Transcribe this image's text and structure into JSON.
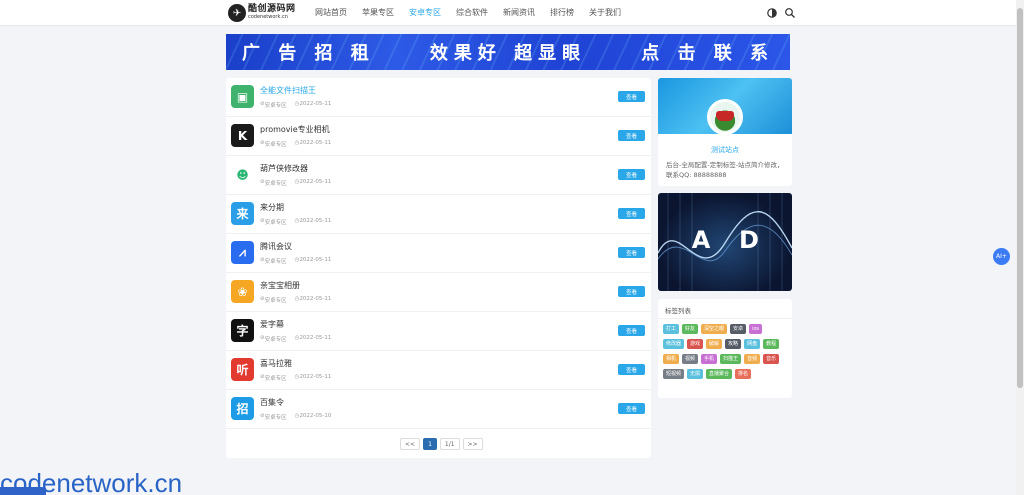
{
  "header": {
    "logo_cn": "酷创源码网",
    "logo_en": "codenetwork.cn",
    "nav": [
      {
        "label": "网站首页",
        "active": false
      },
      {
        "label": "苹果专区",
        "active": false
      },
      {
        "label": "安卓专区",
        "active": true
      },
      {
        "label": "综合软件",
        "active": false
      },
      {
        "label": "新闻资讯",
        "active": false
      },
      {
        "label": "排行榜",
        "active": false
      },
      {
        "label": "关于我们",
        "active": false
      }
    ],
    "icons": [
      "theme-toggle-icon",
      "search-icon"
    ]
  },
  "banner": {
    "text_left": "广 告 招 租",
    "text_mid": "效果好 超显眼",
    "text_right": "点 击 联 系"
  },
  "apps": [
    {
      "name": "全能文件扫描王",
      "category": "安卓专区",
      "date": "2022-05-11",
      "icon": "scanner-icon",
      "color": "#3fb36d",
      "glyph": "▣",
      "highlight": true
    },
    {
      "name": "promovie专业相机",
      "category": "安卓专区",
      "date": "2022-05-11",
      "icon": "camera-app-icon",
      "color": "#1a1a1a",
      "glyph": "K",
      "highlight": false
    },
    {
      "name": "葫芦侠修改器",
      "category": "安卓专区",
      "date": "2022-05-11",
      "icon": "gourd-icon",
      "color": "#ffffff",
      "glyph": "☻",
      "highlight": false
    },
    {
      "name": "来分期",
      "category": "安卓专区",
      "date": "2022-05-11",
      "icon": "installment-icon",
      "color": "#2a9fe8",
      "glyph": "来",
      "highlight": false
    },
    {
      "name": "腾讯会议",
      "category": "安卓专区",
      "date": "2022-05-11",
      "icon": "meeting-icon",
      "color": "#2a6cf0",
      "glyph": "⩘",
      "highlight": false
    },
    {
      "name": "亲宝宝相册",
      "category": "安卓专区",
      "date": "2022-05-11",
      "icon": "baby-album-icon",
      "color": "#f5a623",
      "glyph": "❀",
      "highlight": false
    },
    {
      "name": "爱字幕",
      "category": "安卓专区",
      "date": "2022-05-11",
      "icon": "subtitle-icon",
      "color": "#111111",
      "glyph": "字",
      "highlight": false
    },
    {
      "name": "喜马拉雅",
      "category": "安卓专区",
      "date": "2022-05-11",
      "icon": "audio-listen-icon",
      "color": "#e23a2e",
      "glyph": "听",
      "highlight": false
    },
    {
      "name": "百集令",
      "category": "安卓专区",
      "date": "2022-05-10",
      "icon": "recruit-icon",
      "color": "#1e9be6",
      "glyph": "招",
      "highlight": false
    }
  ],
  "view_label": "查看",
  "pager": {
    "prev": "<<",
    "current": "1",
    "pages": "1/1",
    "next": ">>"
  },
  "profile": {
    "site_name": "测试站点",
    "description": "后台-全局配置-定制标签-站点简介修改，联系QQ: 88888888"
  },
  "ad": {
    "letters": [
      "A",
      "D"
    ]
  },
  "tags": {
    "title": "标签列表",
    "items": [
      {
        "label": "打工",
        "color": "#5bc0de"
      },
      {
        "label": "好友",
        "color": "#5cb85c"
      },
      {
        "label": "深空之眼",
        "color": "#f0ad4e"
      },
      {
        "label": "安卓",
        "color": "#555c66"
      },
      {
        "label": "ios",
        "color": "#c86fd4"
      },
      {
        "label": "修改器",
        "color": "#5bc0de"
      },
      {
        "label": "游戏",
        "color": "#d9534f"
      },
      {
        "label": "破解",
        "color": "#f0ad4e"
      },
      {
        "label": "攻略",
        "color": "#555c66"
      },
      {
        "label": "网盘",
        "color": "#5bc0de"
      },
      {
        "label": "教程",
        "color": "#5cb85c"
      },
      {
        "label": "相机",
        "color": "#f0ad4e"
      },
      {
        "label": "视频",
        "color": "#777d86"
      },
      {
        "label": "手机",
        "color": "#c86fd4"
      },
      {
        "label": "扫描王",
        "color": "#5cb85c"
      },
      {
        "label": "音频",
        "color": "#f0ad4e"
      },
      {
        "label": "音乐",
        "color": "#d9534f"
      },
      {
        "label": "短视频",
        "color": "#777d86"
      },
      {
        "label": "无损",
        "color": "#5bc0de"
      },
      {
        "label": "直播聚合",
        "color": "#5cb85c"
      },
      {
        "label": "排名",
        "color": "#e86f5a"
      }
    ]
  },
  "ai_button": "AI+",
  "watermark": "codenetwork.cn",
  "colors": {
    "accent": "#2aa7e8",
    "background": "#f2f4f7",
    "banner": "#1f43d4"
  }
}
